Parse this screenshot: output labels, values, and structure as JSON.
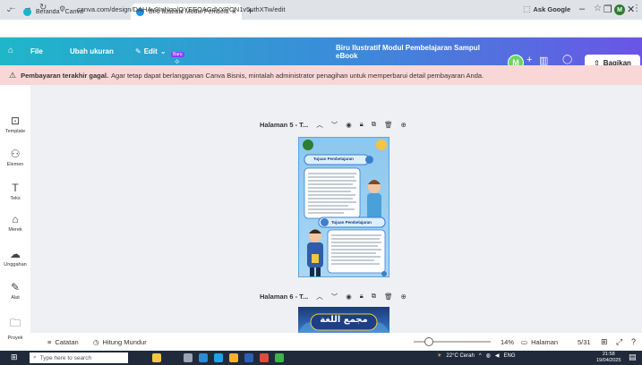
{
  "browser": {
    "tabs": [
      {
        "label": "Beranda - Canva",
        "active": false,
        "icon": "canva-icon"
      },
      {
        "label": "Biru Ilustratif Modul Pembelaja",
        "active": true,
        "icon": "canva-icon"
      }
    ],
    "url": "canva.com/design/DAHAv9InNqo/QYEEOAGdVYPON1v5uthXTw/edit",
    "ask_google": "Ask Google",
    "profile_initial": "M"
  },
  "toolbar": {
    "file": "File",
    "resize": "Ubah ukuran",
    "edit": "Edit",
    "new_badge": "Baru",
    "design_title": "Biru Ilustratif Modul Pembelajaran Sampul eBook",
    "avatar_initial": "M",
    "share": "Bagikan"
  },
  "banner": {
    "bold": "Pembayaran terakhir gagal.",
    "text": "Agar tetap dapat berlangganan Canva Bisnis, mintalah administrator penagihan untuk memperbarui detail pembayaran Anda."
  },
  "sidebar": {
    "items": [
      {
        "label": "Template",
        "icon": "template-icon"
      },
      {
        "label": "Elemen",
        "icon": "elements-icon"
      },
      {
        "label": "Teks",
        "icon": "text-icon"
      },
      {
        "label": "Merek",
        "icon": "brand-icon"
      },
      {
        "label": "Unggahan",
        "icon": "upload-icon"
      },
      {
        "label": "Alat",
        "icon": "tools-icon"
      },
      {
        "label": "Proyek",
        "icon": "folder-icon"
      }
    ]
  },
  "pages": [
    {
      "header": "Halaman 5 - T..."
    },
    {
      "header": "Halaman 6 - T..."
    }
  ],
  "page5_content": {
    "heading1": "Tujuan Pembelajaran",
    "heading2": "Tujuan Pembelajaran"
  },
  "page6_content": {
    "arabic": "مجمع اللغة"
  },
  "status": {
    "notes": "Catatan",
    "timer": "Hitung Mundur",
    "zoom": "14%",
    "zoom_fraction": 0.14,
    "pages_label": "Halaman",
    "page_count": "5/31"
  },
  "taskbar": {
    "search_placeholder": "Type here to search",
    "weather": "22°C Cerah",
    "lang": "ENG",
    "time": "21:58",
    "date": "19/04/2025"
  }
}
